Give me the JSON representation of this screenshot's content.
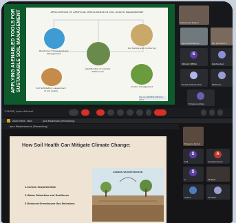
{
  "top_meeting": {
    "slide": {
      "vertical_title": "APPLYING AI-ENABLED TOOLS FOR SUSTAINABLE SOIL MANAGEMENT",
      "heading": "APPLICATIONS OF ARTIFICIAL INTELLIGENCE IN SOIL HEALTH MANAGEMENT",
      "items": [
        "Monitoring of Crop and Land Management",
        "Identification of nutrient deficiencies",
        "Soil testing and monitoring",
        "Soil fertilization: Assessment of soil quality",
        "Control management"
      ],
      "footer": "Source: REVIEW ARTICLE, 2021"
    },
    "participants": [
      {
        "name": "Kathmandu Ragnar",
        "initial": ""
      },
      {
        "name": "Janu Rmakrishnan",
        "initial": ""
      },
      {
        "name": "DR. MOOKIAH S",
        "initial": ""
      },
      {
        "name": "PRASAD MEENA",
        "initial": "S"
      },
      {
        "name": "Rohitha Ram",
        "initial": ""
      },
      {
        "name": "Dinesh Valerian Tanu",
        "initial": ""
      },
      {
        "name": "KR Shivan",
        "initial": ""
      },
      {
        "name": "Tomoka Lal Dios",
        "initial": ""
      }
    ],
    "toolbar_left": "1:56 PM | kpm-nfxb-dmf"
  },
  "bottom_meeting": {
    "tabs": [
      "Zoom Meet - Main",
      "Jana Maaheswar (Presenting)"
    ],
    "presenter_label": "Jana Maaheswaran (Presenting)",
    "slide": {
      "title": "How Soil Health Can Mitigate Climate Change:",
      "points": [
        "1.Carbon Sequestration",
        "2.Water Retention and Resilience",
        "3.Reduced Greenhouse Gas Emissions"
      ],
      "diagram_label": "CARBON SEQUESTRATION"
    },
    "participants": [
      {
        "name": "Prasanna Kumar",
        "initial": ""
      },
      {
        "name": "S M",
        "initial": "S"
      },
      {
        "name": "Anantha Kumar",
        "initial": "A"
      },
      {
        "name": "S",
        "initial": "S"
      },
      {
        "name": "AB Mani",
        "initial": ""
      },
      {
        "name": "Anand",
        "initial": ""
      },
      {
        "name": "AS Velan",
        "initial": ""
      }
    ]
  },
  "colors": {
    "slide_green": "#0e5a2c",
    "end_call": "#d93025",
    "avatar_purple": "#5f3ea8",
    "tab_active": "#d9a520"
  }
}
